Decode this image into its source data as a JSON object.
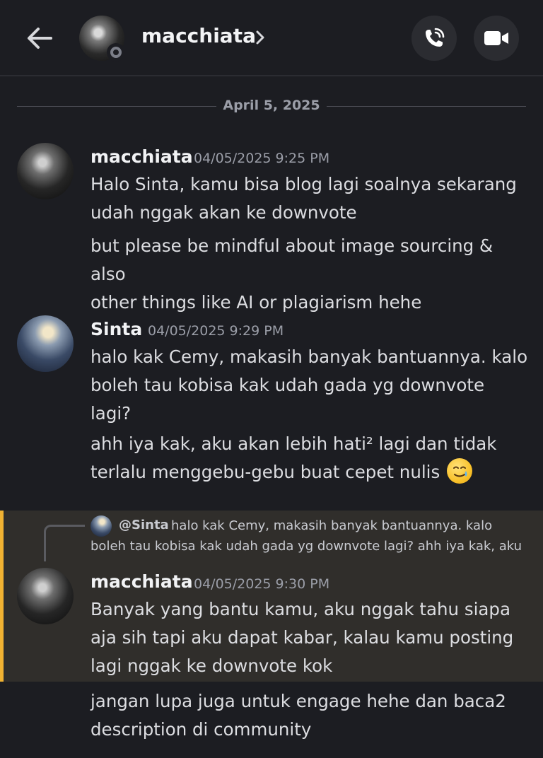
{
  "header": {
    "title": "macchiata",
    "back_icon": "arrow-left-icon",
    "call_icon": "phone-icon",
    "video_icon": "video-camera-icon"
  },
  "date_divider": "April 5, 2025",
  "messages": [
    {
      "author": "macchiata",
      "timestamp": "04/05/2025 9:25 PM",
      "paragraphs": [
        [
          "Halo Sinta, kamu bisa blog lagi soalnya sekarang",
          "udah nggak akan ke downvote"
        ],
        [
          "but please be mindful about image sourcing & also",
          "other things like AI or plagiarism hehe"
        ]
      ]
    },
    {
      "author": "Sinta",
      "timestamp": "04/05/2025 9:29 PM",
      "paragraphs": [
        [
          "halo kak Cemy, makasih banyak bantuannya. kalo",
          "boleh tau kobisa kak udah gada yg downvote lagi?"
        ],
        [
          "ahh iya kak, aku akan lebih hati² lagi dan tidak",
          "terlalu menggebu-gebu buat cepet nulis"
        ]
      ],
      "emoji": "crying-smile-emoji"
    },
    {
      "reply_to": {
        "user": "@Sinta",
        "line1": "halo kak Cemy, makasih banyak bantuannya. kalo",
        "line2": "boleh tau kobisa kak udah gada yg downvote lagi?  ahh iya kak, aku"
      },
      "author": "macchiata",
      "timestamp": "04/05/2025 9:30 PM",
      "paragraphs": [
        [
          "Banyak yang bantu kamu, aku nggak tahu siapa",
          "aja sih tapi aku dapat kabar, kalau kamu posting",
          "lagi nggak ke downvote kok"
        ],
        [
          "jangan lupa juga untuk engage hehe dan baca2",
          "description di community"
        ]
      ]
    }
  ],
  "colors": {
    "background": "#1c1d22",
    "highlight": "#302e2b",
    "highlight_bar": "#f0b232"
  }
}
